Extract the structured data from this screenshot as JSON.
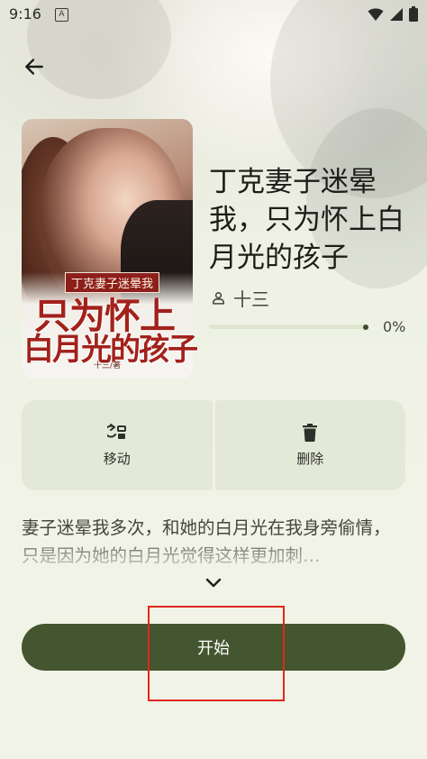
{
  "status_bar": {
    "time": "9:16",
    "notification_icon": "a-badge-icon",
    "icons": [
      "wifi-icon",
      "signal-icon",
      "battery-icon"
    ]
  },
  "navigation": {
    "back_icon": "arrow-left-icon"
  },
  "book": {
    "cover": {
      "subtitle": "丁克妻子迷晕我",
      "title_line1": "只为怀上",
      "title_line2": "白月光的孩子",
      "author_credit": "十三/著"
    },
    "title": "丁克妻子迷晕我，只为怀上白月光的孩子",
    "author_icon": "person-icon",
    "author": "十三",
    "progress_text": "0%",
    "progress_fraction": 0.0
  },
  "actions": {
    "move": {
      "icon": "move-icon",
      "label": "移动"
    },
    "delete": {
      "icon": "trash-icon",
      "label": "删除"
    }
  },
  "description": {
    "text": "妻子迷晕我多次，和她的白月光在我身旁偷情，只是因为她的白月光觉得这样更加刺…",
    "expand_icon": "chevron-down-icon"
  },
  "start_button": {
    "label": "开始"
  },
  "colors": {
    "primary": "#44562f",
    "surface": "#f0f3e6",
    "action_surface": "#e4e8d8",
    "highlight": "#e1271d"
  }
}
